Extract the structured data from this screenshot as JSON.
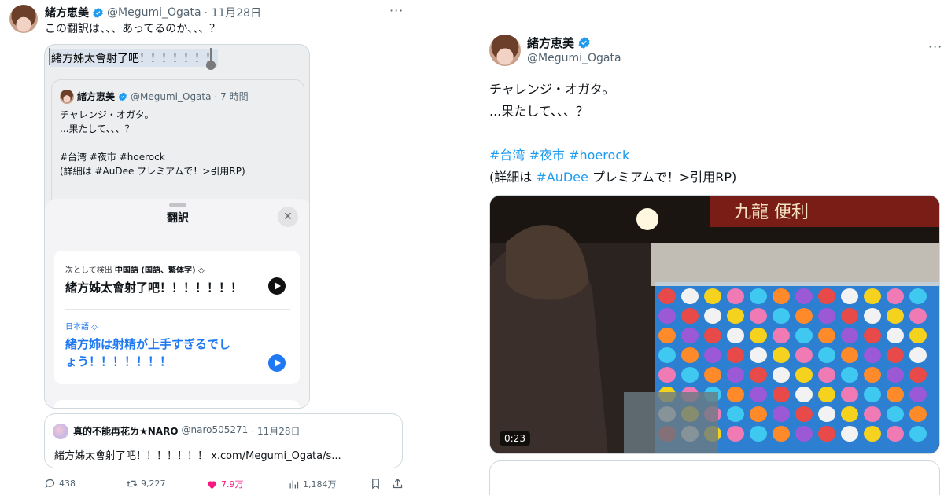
{
  "left_tweet": {
    "author": {
      "name": "緒方恵美",
      "handle": "@Megumi_Ogata",
      "date": "· 11月28日"
    },
    "more": "···",
    "text": "この翻訳は、、、あってるのか、、、？",
    "screenshot": {
      "selected_text": "緒方姊太會射了吧！！！！！！！",
      "inner_tweet": {
        "name": "緒方恵美",
        "handle": "@Megumi_Ogata",
        "time": "· 7 時間",
        "lines": [
          "チャレンジ・オガタ。",
          "...果たして、、、？",
          "",
          "#台湾 #夜市 #hoerock",
          "(詳細は #AuDee プレミアムで！>引用RP)"
        ]
      },
      "sheet": {
        "title": "翻訳",
        "close": "✕",
        "source_prefix": "次として検出",
        "source_language": "中国語 (国語、繁体字) ◇",
        "source_text": "緒方姊太會射了吧！！！！！！！",
        "target_language": "日本語 ◇",
        "target_text": "緒方姉は射精が上手すぎるでしょう！！！！！！！"
      }
    },
    "quote": {
      "name": "真的不能再花ㄌ★NARO",
      "handle": "@naro505271",
      "date": "· 11月28日",
      "text": "緒方姊太會射了吧！！！！！！！ x.com/Megumi_Ogata/s..."
    },
    "actions": {
      "replies": "438",
      "reposts": "9,227",
      "likes": "7.9万",
      "views": "1,184万"
    }
  },
  "right_tweet": {
    "author": {
      "name": "緒方恵美",
      "handle": "@Megumi_Ogata"
    },
    "more": "···",
    "line1": "チャレンジ・オガタ。",
    "line2": "...果たして、、、？",
    "tags": [
      "#台湾",
      "#夜市",
      "#hoerock"
    ],
    "detail_prefix": "(詳細は ",
    "detail_tag": "#AuDee",
    "detail_suffix": " プレミアムで！>引用RP)",
    "video": {
      "duration": "0:23",
      "sign_text": "九龍 便利"
    }
  },
  "colors": {
    "link": "#1d9bf0",
    "like": "#f91880",
    "secondary": "#536471",
    "ios_blue": "#1d78f2"
  }
}
